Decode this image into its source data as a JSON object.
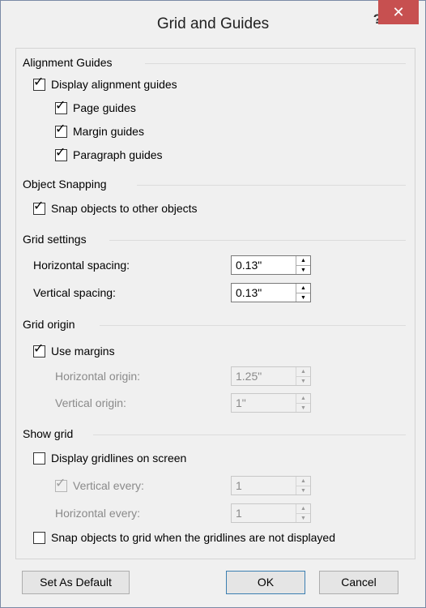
{
  "dialog": {
    "title": "Grid and Guides",
    "help_label": "?",
    "close_label": "✕"
  },
  "alignment_guides": {
    "header": "Alignment Guides",
    "display": {
      "label": "Display alignment guides",
      "checked": true
    },
    "page": {
      "label": "Page guides",
      "checked": true
    },
    "margin": {
      "label": "Margin guides",
      "checked": true
    },
    "paragraph": {
      "label": "Paragraph guides",
      "checked": true
    }
  },
  "object_snapping": {
    "header": "Object Snapping",
    "snap": {
      "label": "Snap objects to other objects",
      "checked": true
    }
  },
  "grid_settings": {
    "header": "Grid settings",
    "horizontal": {
      "label": "Horizontal spacing:",
      "value": "0.13\""
    },
    "vertical": {
      "label": "Vertical spacing:",
      "value": "0.13\""
    }
  },
  "grid_origin": {
    "header": "Grid origin",
    "use_margins": {
      "label": "Use margins",
      "checked": true
    },
    "horizontal": {
      "label": "Horizontal origin:",
      "value": "1.25\""
    },
    "vertical": {
      "label": "Vertical origin:",
      "value": "1\""
    }
  },
  "show_grid": {
    "header": "Show grid",
    "display_gridlines": {
      "label": "Display gridlines on screen",
      "checked": false
    },
    "vertical_every": {
      "label": "Vertical every:",
      "value": "1",
      "checked": true
    },
    "horizontal_every": {
      "label": "Horizontal every:",
      "value": "1"
    },
    "snap_when_hidden": {
      "label": "Snap objects to grid when the gridlines are not displayed",
      "checked": false
    }
  },
  "buttons": {
    "set_default": "Set As Default",
    "ok": "OK",
    "cancel": "Cancel"
  },
  "icons": [
    "checkmark-icon",
    "spin-up-icon",
    "spin-down-icon",
    "close-icon",
    "help-icon"
  ]
}
